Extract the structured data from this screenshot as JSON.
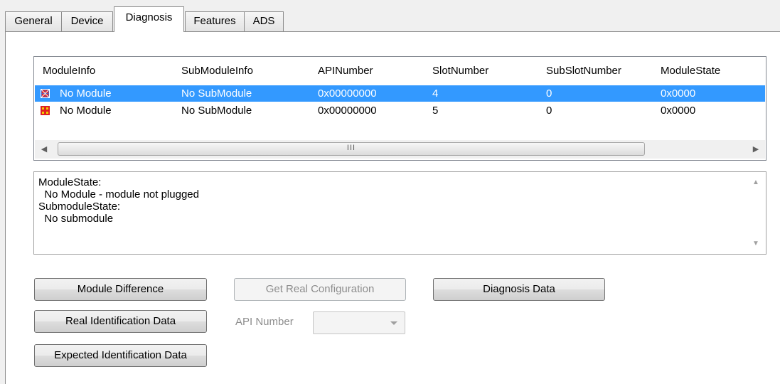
{
  "tabs": [
    {
      "label": "General"
    },
    {
      "label": "Device"
    },
    {
      "label": "Diagnosis"
    },
    {
      "label": "Features"
    },
    {
      "label": "ADS"
    }
  ],
  "active_tab": "Diagnosis",
  "table": {
    "columns": [
      "ModuleInfo",
      "SubModuleInfo",
      "APINumber",
      "SlotNumber",
      "SubSlotNumber",
      "ModuleState"
    ],
    "rows": [
      {
        "selected": true,
        "icon": "module-error-icon",
        "cells": [
          "No Module",
          "No SubModule",
          "0x00000000",
          "4",
          "0",
          "0x0000"
        ]
      },
      {
        "selected": false,
        "icon": "module-missing-icon",
        "cells": [
          "No Module",
          "No SubModule",
          "0x00000000",
          "5",
          "0",
          "0x0000"
        ]
      }
    ],
    "scroll_thumb_glyph": "III"
  },
  "details": {
    "lines": [
      "ModuleState:",
      "  No Module - module not plugged",
      "SubmoduleState:",
      "  No submodule"
    ]
  },
  "buttons": {
    "module_difference": "Module Difference",
    "get_real_configuration": "Get Real Configuration",
    "diagnosis_data": "Diagnosis Data",
    "real_identification_data": "Real Identification Data",
    "expected_identification_data": "Expected Identification Data"
  },
  "api_number": {
    "label": "API Number",
    "value": ""
  },
  "colors": {
    "selection": "#3399ff",
    "icon_red": "#e02020",
    "icon_yellow": "#f0d000"
  }
}
